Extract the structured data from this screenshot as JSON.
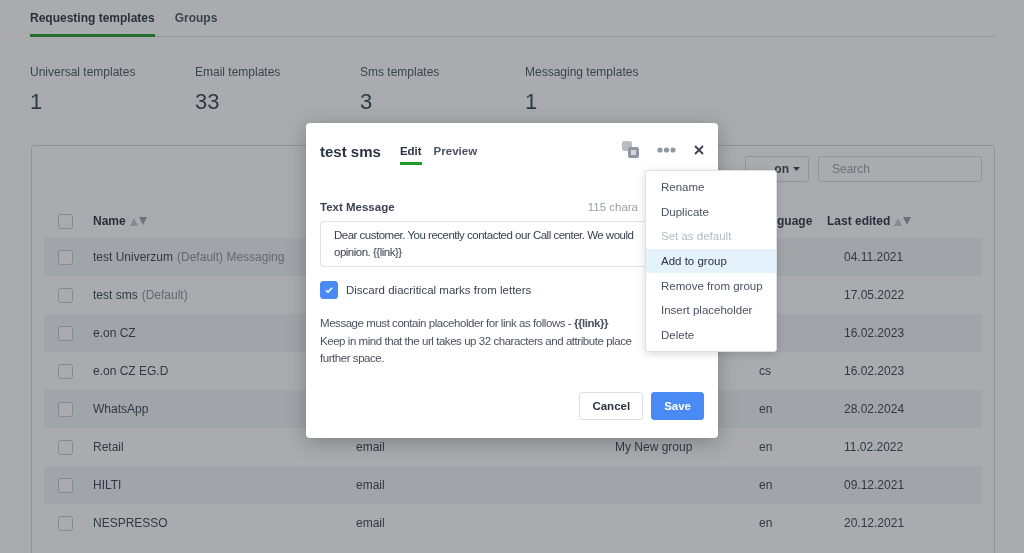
{
  "tabs": [
    {
      "label": "Requesting templates",
      "selected": true
    },
    {
      "label": "Groups",
      "selected": false
    }
  ],
  "stats": [
    {
      "label": "Universal templates",
      "value": "1"
    },
    {
      "label": "Email templates",
      "value": "33"
    },
    {
      "label": "Sms templates",
      "value": "3"
    },
    {
      "label": "Messaging templates",
      "value": "1"
    }
  ],
  "toolbar": {
    "filter_button": "on",
    "search": {
      "placeholder": "Search"
    }
  },
  "table": {
    "header_checked": false,
    "header": {
      "name": "Name",
      "language": "guage",
      "last_edited": "Last edited"
    },
    "rows": [
      {
        "checked": false,
        "name": "test Univerzum",
        "note": "(Default) Messaging",
        "last_edited": "04.11.2021"
      },
      {
        "checked": false,
        "name": "test sms",
        "note": "(Default)",
        "last_edited": "17.05.2022"
      },
      {
        "checked": false,
        "name": "e.on CZ",
        "last_edited": "16.02.2023"
      },
      {
        "checked": false,
        "name": "e.on CZ EG.D",
        "language": "cs",
        "last_edited": "16.02.2023"
      },
      {
        "checked": false,
        "name": "WhatsApp",
        "language": "en",
        "last_edited": "28.02.2024"
      },
      {
        "checked": false,
        "name": "Retail",
        "type": "email",
        "group": "My New group",
        "language": "en",
        "last_edited": "11.02.2022"
      },
      {
        "checked": false,
        "name": "HILTI",
        "type": "email",
        "language": "en",
        "last_edited": "09.12.2021"
      },
      {
        "checked": false,
        "name": "NESPRESSO",
        "type": "email",
        "language": "en",
        "last_edited": "20.12.2021"
      }
    ]
  },
  "modal": {
    "title": "test sms",
    "tabs": [
      {
        "label": "Edit",
        "selected": true
      },
      {
        "label": "Preview",
        "selected": false
      }
    ],
    "field_label": "Text Message",
    "char_count": "115 chara",
    "message_lines": [
      "Dear customer. You recently contacted our Call center. We would",
      "opinion. {{link}}"
    ],
    "discard_diacritics": {
      "label": "Discard diacritical marks from letters",
      "checked": true
    },
    "hint_lines": [
      "Message must contain placeholder for link as follows - **{{link}}**",
      "Keep in mind that the url takes up 32 characters and attribute place",
      "further space."
    ],
    "buttons": {
      "cancel": "Cancel",
      "save": "Save"
    }
  },
  "menu": [
    {
      "label": "Rename",
      "disabled": false,
      "selected": false
    },
    {
      "label": "Duplicate",
      "disabled": false,
      "selected": false
    },
    {
      "label": "Set as default",
      "disabled": true,
      "selected": false
    },
    {
      "label": "Add to group",
      "disabled": false,
      "selected": true
    },
    {
      "label": "Remove from group",
      "disabled": false,
      "selected": false
    },
    {
      "label": "Insert placeholder",
      "disabled": false,
      "selected": false
    },
    {
      "label": "Delete",
      "disabled": false,
      "selected": false
    }
  ]
}
